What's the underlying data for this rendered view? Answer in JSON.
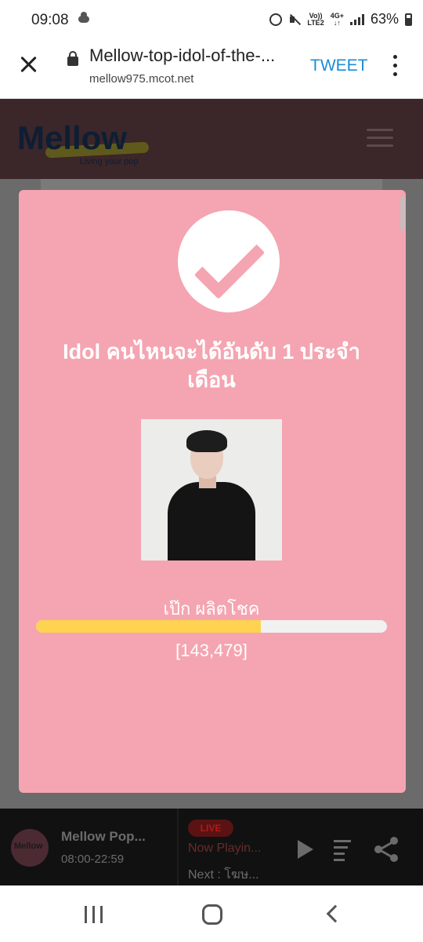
{
  "status_bar": {
    "time": "09:08",
    "network_top": "Vo))",
    "network_bottom": "LTE2",
    "data_top": "4G+",
    "data_bottom": "↓↑",
    "battery": "63%"
  },
  "browser": {
    "title": "Mellow-top-idol-of-the-...",
    "url": "mellow975.mcot.net",
    "tweet_label": "TWEET"
  },
  "site": {
    "logo": "Mellow",
    "tagline": "Living your pop"
  },
  "modal": {
    "title": "Idol คนไหนจะได้อันดับ 1 ประจำเดือน",
    "idol_name": "เป๊ก ผลิตโชค",
    "vote_count": "[143,479]",
    "vote_fraction": 0.64,
    "colors": {
      "background": "#f4a5b1",
      "bar_fill": "#fdd34f",
      "bar_track": "#f1f1f1"
    }
  },
  "player": {
    "logo": "Mellow",
    "title": "Mellow Pop...",
    "time": "08:00-22:59",
    "live_badge": "LIVE",
    "now_playing": "Now Playin...",
    "next": "Next : โฆษ..."
  }
}
